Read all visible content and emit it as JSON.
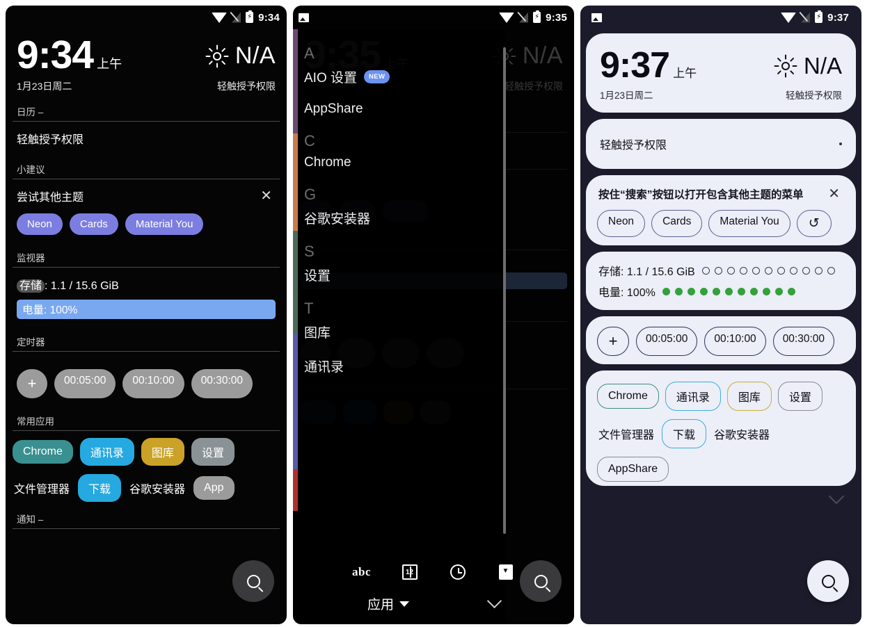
{
  "statusbars": {
    "p1": {
      "time": "9:34",
      "icons": [
        "wifi-icon",
        "signal-off-icon",
        "battery-charging-icon"
      ]
    },
    "p2": {
      "time": "9:35",
      "icons": [
        "photo-icon",
        "wifi-icon",
        "signal-off-icon",
        "battery-charging-icon"
      ]
    },
    "p3": {
      "time": "9:37",
      "icons": [
        "photo-icon",
        "wifi-icon",
        "signal-off-icon",
        "battery-charging-icon"
      ]
    }
  },
  "panel1": {
    "clock": {
      "time": "9:34",
      "ampm": "上午",
      "date": "1月23日周二"
    },
    "weather": {
      "value": "N/A",
      "icon": "sun-icon"
    },
    "permission": "轻触授予权限",
    "sections": {
      "calendar": {
        "title": "日历 –",
        "row": "轻触授予权限"
      },
      "tips": {
        "title": "小建议",
        "headline": "尝试其他主题",
        "close": "✕",
        "themes": [
          "Neon",
          "Cards",
          "Material You"
        ]
      },
      "monitor": {
        "title": "监视器",
        "storage": "存储: 1.1 / 15.6 GiB",
        "storage_label": "存储",
        "storage_value": ": 1.1 / 15.6 GiB",
        "battery": "电量: 100%"
      },
      "timer": {
        "title": "定时器",
        "add": "+",
        "presets": [
          "00:05:00",
          "00:10:00",
          "00:30:00"
        ]
      },
      "apps": {
        "title": "常用应用",
        "row1": [
          {
            "label": "Chrome",
            "color": "#3a9090"
          },
          {
            "label": "通讯录",
            "color": "#26a9e0"
          },
          {
            "label": "图库",
            "color": "#c9a227"
          },
          {
            "label": "设置",
            "color": "#8a9296"
          }
        ],
        "row2": [
          {
            "label": "文件管理器",
            "color": "none"
          },
          {
            "label": "下载",
            "color": "#26a9e0"
          },
          {
            "label": "谷歌安装器",
            "color": "none"
          },
          {
            "label": "App",
            "color": "#9b9b9b"
          }
        ]
      },
      "notifications": {
        "title": "通知 –"
      }
    },
    "fab": "search-icon"
  },
  "panel2": {
    "list": [
      {
        "type": "letter",
        "label": "A"
      },
      {
        "type": "app",
        "label": "AIO 设置",
        "badge": "NEW"
      },
      {
        "type": "app",
        "label": "AppShare",
        "badge": ""
      },
      {
        "type": "letter",
        "label": "C"
      },
      {
        "type": "app",
        "label": "Chrome",
        "badge": ""
      },
      {
        "type": "letter",
        "label": "G"
      },
      {
        "type": "app",
        "label": "谷歌安装器",
        "badge": ""
      },
      {
        "type": "letter",
        "label": "S"
      },
      {
        "type": "app",
        "label": "设置",
        "badge": ""
      },
      {
        "type": "letter",
        "label": "T"
      },
      {
        "type": "app",
        "label": "图库",
        "badge": ""
      },
      {
        "type": "app",
        "label": "通讯录",
        "badge": ""
      }
    ],
    "colorbars": [
      "#6a4a72",
      "#c97b4a",
      "#4a6a5c",
      "#5a5aa8",
      "#b03030"
    ],
    "toolbar": {
      "icons": [
        "abc-sort-icon",
        "number-sort-icon",
        "recent-clock-icon",
        "download-icon"
      ],
      "abc_label": "abc",
      "num_label": "12",
      "mode_label": "应用",
      "collapse": "chevron-down-icon"
    },
    "fab": "search-icon",
    "ghost": {
      "time": "9:35",
      "ampm": "上午",
      "na": "N/A",
      "perm": "轻触授予权限"
    }
  },
  "panel3": {
    "clock": {
      "time": "9:37",
      "ampm": "上午",
      "date": "1月23日周二"
    },
    "weather": {
      "value": "N/A",
      "icon": "sun-icon"
    },
    "permission": "轻触授予权限",
    "tips": {
      "headline": "按住“搜索”按钮以打开包含其他主题的菜单",
      "close": "✕",
      "themes": [
        "Neon",
        "Cards",
        "Material You"
      ],
      "reset": "↺"
    },
    "monitor": {
      "storage": "存储: 1.1 / 15.6 GiB",
      "battery": "电量: 100%",
      "storage_pips": 11,
      "battery_pips": 11
    },
    "timer": {
      "add": "+",
      "presets": [
        "00:05:00",
        "00:10:00",
        "00:30:00"
      ]
    },
    "apps": {
      "row1": [
        {
          "label": "Chrome",
          "color": "#3e8f85"
        },
        {
          "label": "通讯录",
          "color": "#3aaede"
        },
        {
          "label": "图库",
          "color": "#c9ad3a"
        },
        {
          "label": "设置",
          "color": "#8b8b93"
        }
      ],
      "row2": [
        {
          "label": "文件管理器",
          "color": "none"
        },
        {
          "label": "下载",
          "color": "#3aaede"
        },
        {
          "label": "谷歌安装器",
          "color": "none"
        }
      ],
      "row3": [
        {
          "label": "AppShare",
          "color": "#8b8b93"
        }
      ]
    },
    "fab": "search-icon"
  }
}
